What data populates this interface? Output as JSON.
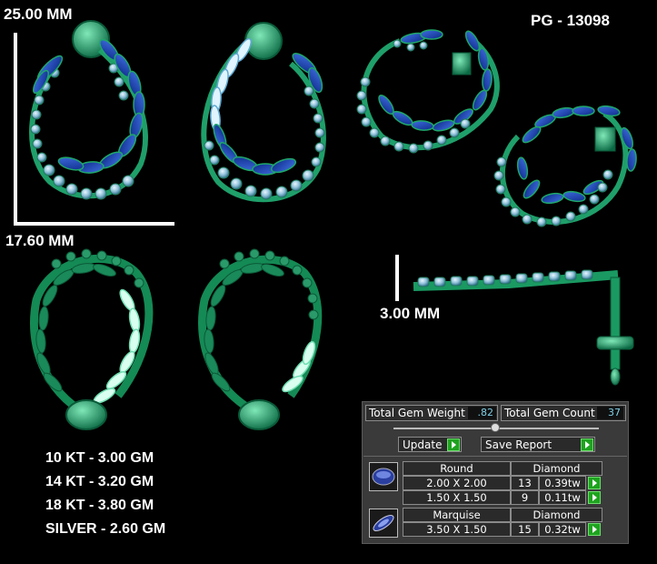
{
  "header": {
    "code": "PG - 13098"
  },
  "dimensions": {
    "height": "25.00 MM",
    "width": "17.60 MM",
    "depth": "3.00 MM"
  },
  "metal_weights": [
    "10 KT - 3.00 GM",
    "14 KT - 3.20 GM",
    "18 KT - 3.80 GM",
    "SILVER - 2.60 GM"
  ],
  "gem_panel": {
    "total_weight_label": "Total Gem Weight",
    "total_weight_value": ".82",
    "total_count_label": "Total Gem Count",
    "total_count_value": "37",
    "update_label": "Update",
    "save_report_label": "Save Report",
    "groups": [
      {
        "shape": "Round",
        "material": "Diamond",
        "thumb_icon": "round-gem-icon",
        "rows": [
          {
            "size": "2.00 X 2.00",
            "count": "13",
            "weight": "0.39tw"
          },
          {
            "size": "1.50 X 1.50",
            "count": "9",
            "weight": "0.11tw"
          }
        ]
      },
      {
        "shape": "Marquise",
        "material": "Diamond",
        "thumb_icon": "marquise-gem-icon",
        "rows": [
          {
            "size": "3.50 X 1.50",
            "count": "15",
            "weight": "0.32tw"
          }
        ]
      }
    ]
  },
  "colors": {
    "metal": "#1fa76a",
    "marquise": "#1a3fa8",
    "round": "#8fc7dc",
    "accent_arrow": "#1fa31f"
  }
}
